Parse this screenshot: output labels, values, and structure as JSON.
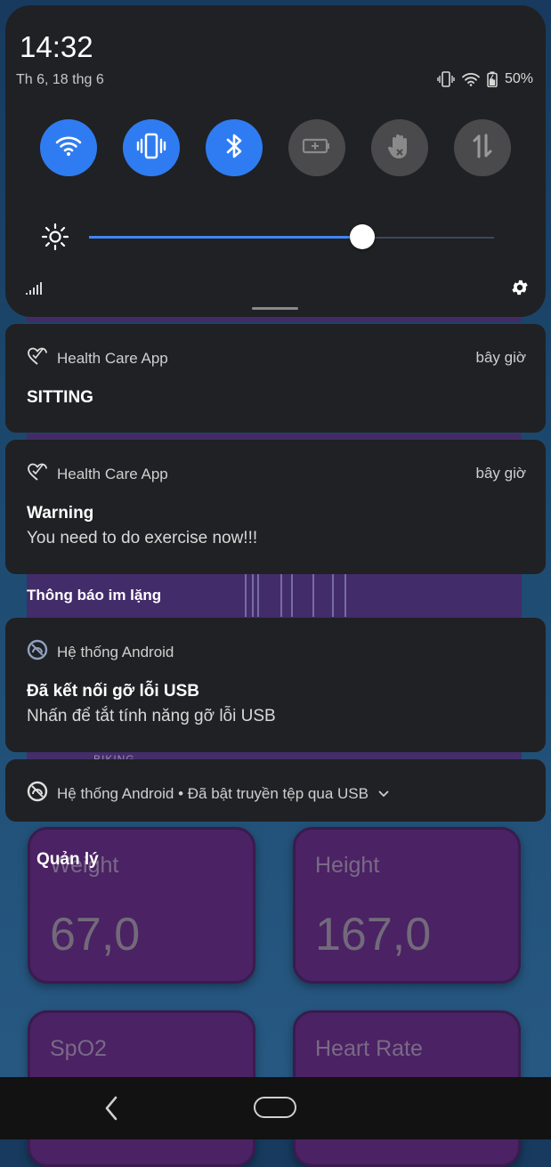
{
  "quick_settings": {
    "time": "14:32",
    "date": "Th 6, 18 thg 6",
    "battery": "50%",
    "tiles": [
      {
        "icon": "wifi-icon",
        "state": "on"
      },
      {
        "icon": "vibrate-icon",
        "state": "on"
      },
      {
        "icon": "bluetooth-icon",
        "state": "on"
      },
      {
        "icon": "battery-saver-icon",
        "state": "off"
      },
      {
        "icon": "do-not-disturb-hand-icon",
        "state": "off"
      },
      {
        "icon": "mobile-data-icon",
        "state": "off"
      }
    ],
    "brightness_level": 0.675
  },
  "notifications": [
    {
      "app": "Health Care App",
      "time": "bây giờ",
      "title": "SITTING"
    },
    {
      "app": "Health Care App",
      "time": "bây giờ",
      "title": "Warning",
      "text": "You need to do exercise now!!!"
    }
  ],
  "silent_section_title": "Thông báo im lặng",
  "silent_notifications": [
    {
      "app": "Hệ thống Android",
      "title": "Đã kết nối gỡ lỗi USB",
      "text": "Nhấn để tắt tính năng gỡ lỗi USB"
    },
    {
      "summary": "Hệ thống Android • Đã bật truyền tệp qua USB"
    }
  ],
  "background_app": {
    "section_title": "Quản lý",
    "biking_label": "BIKING",
    "cards": [
      {
        "label": "Weight",
        "value": "67,0"
      },
      {
        "label": "Height",
        "value": "167,0"
      },
      {
        "label": "SpO2",
        "value": ""
      },
      {
        "label": "Heart Rate",
        "value": ""
      }
    ]
  },
  "colors": {
    "accent": "#2f7cf2",
    "panel": "#202124",
    "card": "#4b2264"
  }
}
